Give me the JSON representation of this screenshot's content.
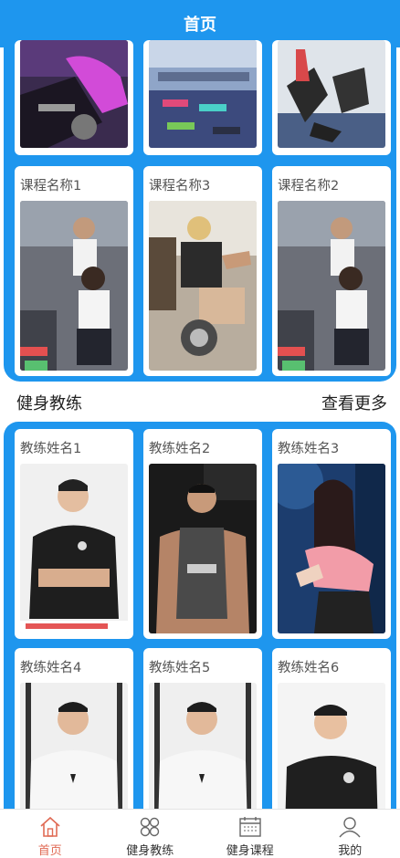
{
  "header": {
    "title": "首页"
  },
  "courses": {
    "items": [
      {
        "name": ""
      },
      {
        "name": ""
      },
      {
        "name": ""
      },
      {
        "name": "课程名称1"
      },
      {
        "name": "课程名称3"
      },
      {
        "name": "课程名称2"
      }
    ]
  },
  "coaches_section": {
    "title": "健身教练",
    "more": "查看更多",
    "items": [
      {
        "name": "教练姓名1"
      },
      {
        "name": "教练姓名2"
      },
      {
        "name": "教练姓名3"
      },
      {
        "name": "教练姓名4"
      },
      {
        "name": "教练姓名5"
      },
      {
        "name": "教练姓名6"
      }
    ]
  },
  "tabbar": {
    "items": [
      {
        "label": "首页",
        "icon": "home-icon",
        "active": true
      },
      {
        "label": "健身教练",
        "icon": "grid-icon",
        "active": false
      },
      {
        "label": "健身课程",
        "icon": "calendar-icon",
        "active": false
      },
      {
        "label": "我的",
        "icon": "user-icon",
        "active": false
      }
    ]
  },
  "colors": {
    "brand": "#1e96ee",
    "active_tab": "#e06a54"
  }
}
